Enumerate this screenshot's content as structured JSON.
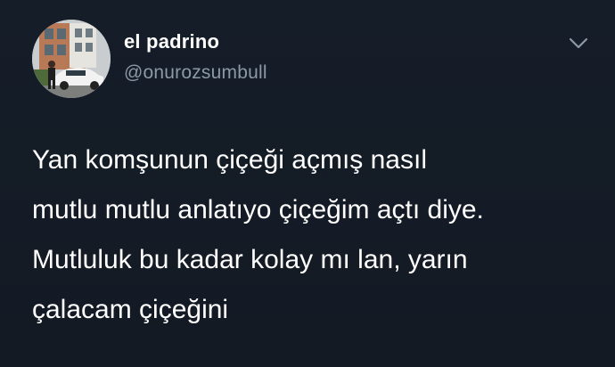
{
  "tweet": {
    "author": {
      "display_name": "el padrino",
      "handle": "@onurozsumbull",
      "avatar_icon": "profile-photo"
    },
    "menu_icon": "chevron-down-icon",
    "text_lines": [
      "Yan komşunun çiçeği açmış nasıl",
      "mutlu mutlu anlatıyo çiçeğim açtı diye.",
      "Mutluluk bu kadar kolay mı lan, yarın",
      "çalacam çiçeğini"
    ]
  },
  "colors": {
    "background": "#141c26",
    "text_primary": "#ffffff",
    "text_secondary": "#8b98a5"
  }
}
